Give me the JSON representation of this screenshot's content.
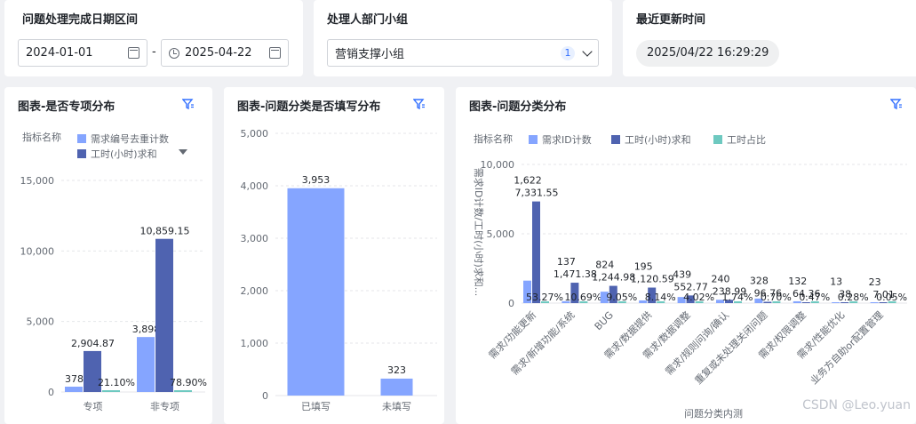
{
  "filters": {
    "date_range": {
      "title": "问题处理完成日期区间",
      "start": "2024-01-01",
      "separator": "-",
      "end": "2025-04-22"
    },
    "department": {
      "title": "处理人部门小组",
      "value": "营销支撑小组",
      "count": "1"
    },
    "updated": {
      "title": "最近更新时间",
      "value": "2025/04/22 16:29:29"
    }
  },
  "charts": {
    "special": {
      "title": "图表-是否专项分布",
      "legend_label": "指标名称"
    },
    "filled": {
      "title": "图表-问题分类是否填写分布"
    },
    "category": {
      "title": "图表-问题分类分布",
      "legend_label": "指标名称"
    }
  },
  "colors": {
    "light_blue": "#85a5ff",
    "dark_blue": "#4f63b0",
    "teal": "#6ec9c0",
    "accent": "#3370ff"
  },
  "chart_data": [
    {
      "type": "bar",
      "title": "图表-是否专项分布",
      "categories": [
        "专项",
        "非专项"
      ],
      "series": [
        {
          "name": "需求编号去重计数",
          "values": [
            378,
            3898
          ],
          "labels": [
            "378",
            "3,898"
          ]
        },
        {
          "name": "工时(小时)求和",
          "values": [
            2904.87,
            10859.15
          ],
          "labels": [
            "2,904.87",
            "10,859.15"
          ]
        },
        {
          "name": "",
          "values": [
            21.1,
            78.9
          ],
          "labels": [
            "21.10%",
            "78.90%"
          ]
        }
      ],
      "yticks": [
        "0",
        "5,000",
        "10,000",
        "15,000"
      ],
      "ylim": [
        0,
        15000
      ]
    },
    {
      "type": "bar",
      "title": "图表-问题分类是否填写分布",
      "categories": [
        "已填写",
        "未填写"
      ],
      "values": [
        3953,
        323
      ],
      "labels": [
        "3,953",
        "323"
      ],
      "yticks": [
        "0",
        "1,000",
        "2,000",
        "3,000",
        "4,000",
        "5,000"
      ],
      "ylim": [
        0,
        5000
      ]
    },
    {
      "type": "bar",
      "title": "图表-问题分类分布",
      "xlabel": "问题分类内测",
      "ylabel": "需求ID计数/工时(小时)求和...",
      "categories": [
        "需求/功能更新",
        "需求/新增功能/系统",
        "BUG",
        "需求/数据提供",
        "需求/数据调整",
        "需求/规则问询/确认",
        "重复或未处理关闭问题",
        "需求/权限调整",
        "需求/性能优化",
        "业务方自助or配置管理"
      ],
      "series": [
        {
          "name": "需求ID计数",
          "values": [
            1622,
            137,
            824,
            195,
            439,
            240,
            328,
            132,
            13,
            23
          ],
          "labels": [
            "1,622",
            "137",
            "824",
            "195",
            "439",
            "240",
            "328",
            "132",
            "13",
            "23"
          ]
        },
        {
          "name": "工时(小时)求和",
          "values": [
            7331.55,
            1471.38,
            1244.98,
            1120.59,
            552.77,
            238.99,
            96.76,
            64.36,
            38,
            7.01
          ],
          "labels": [
            "7,331.55",
            "1,471.38",
            "1,244.98",
            "1,120.59",
            "552.77",
            "238.99",
            "96.76",
            "64.36",
            "38",
            "7.01"
          ]
        },
        {
          "name": "工时占比",
          "values": [
            53.27,
            10.69,
            9.05,
            8.14,
            4.02,
            1.74,
            0.7,
            0.47,
            0.28,
            0.05
          ],
          "labels": [
            "53.27%",
            "10.69%",
            "9.05%",
            "8.14%",
            "4.02%",
            "1.74%",
            "0.70%",
            "0.47%",
            "0.28%",
            "0.05%"
          ]
        }
      ],
      "yticks": [
        "0",
        "5,000",
        "10,000"
      ],
      "ylim": [
        0,
        10000
      ]
    }
  ],
  "watermark": "CSDN @Leo.yuan"
}
